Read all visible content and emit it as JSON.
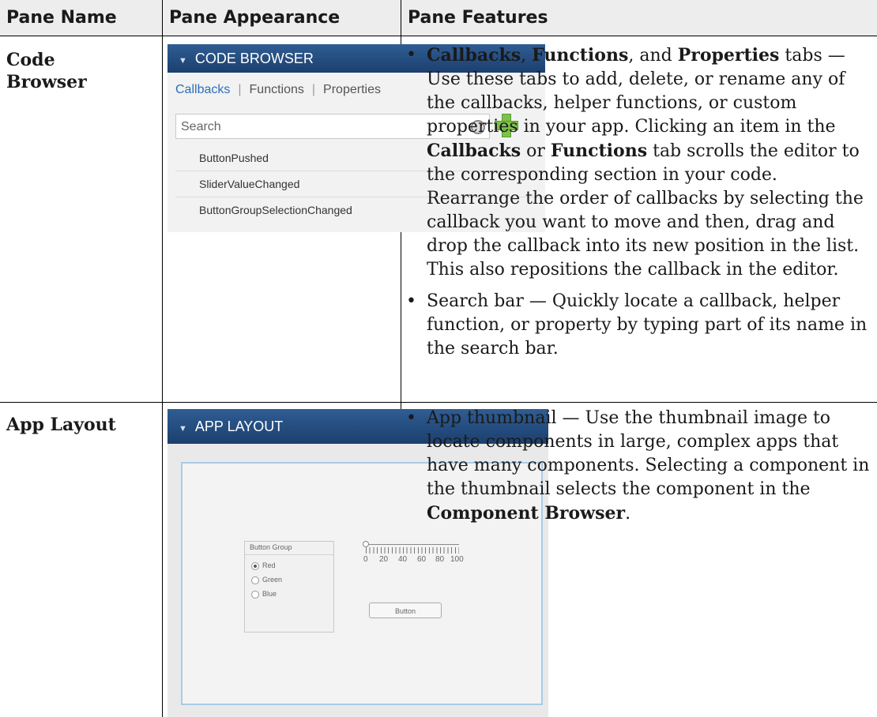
{
  "table": {
    "headers": [
      "Pane Name",
      "Pane Appearance",
      "Pane Features"
    ],
    "rows": [
      {
        "name_lines": [
          "Code",
          "Browser"
        ],
        "features": [
          {
            "b1": "Callbacks",
            "t1": ", ",
            "b2": "Functions",
            "t2": ", and ",
            "b3": "Properties",
            "t3": " tabs — Use these tabs to add, delete, or rename any of the callbacks, helper functions, or custom properties in your app. Clicking an item in the ",
            "b4": "Callbacks",
            "t4": " or ",
            "b5": "Functions",
            "t5": " tab scrolls the editor to the corresponding section in your code. Rearrange the order of callbacks by selecting the callback you want to move and then, drag and drop the callback into its new position in the list. This also repositions the callback in the editor."
          },
          {
            "text": "Search bar — Quickly locate a callback, helper function, or property by typing part of its name in the search bar."
          }
        ]
      },
      {
        "name": "App Layout",
        "features": [
          {
            "t1": "App thumbnail — Use the thumbnail image to locate components in large, complex apps that have many components. Selecting a component in the thumbnail selects the component in the ",
            "b1": "Component Browser",
            "t2": "."
          }
        ]
      }
    ]
  },
  "code_browser": {
    "title": "CODE BROWSER",
    "tabs": [
      "Callbacks",
      "Functions",
      "Properties"
    ],
    "search_placeholder": "Search",
    "items": [
      "ButtonPushed",
      "SliderValueChanged",
      "ButtonGroupSelectionChanged"
    ]
  },
  "app_layout": {
    "title": "APP LAYOUT",
    "button_group_title": "Button Group",
    "radios": [
      "Red",
      "Green",
      "Blue"
    ],
    "slider_ticks": [
      "0",
      "20",
      "40",
      "60",
      "80",
      "100"
    ],
    "button_label": "Button"
  }
}
